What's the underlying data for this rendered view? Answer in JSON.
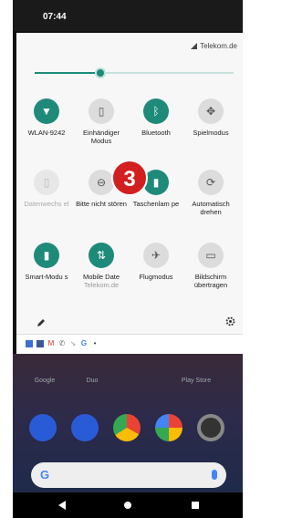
{
  "status_bar": {
    "time": "07:44"
  },
  "quick_settings": {
    "carrier": "Telekom.de",
    "brightness": 0.33,
    "tiles": [
      {
        "name": "wifi",
        "label": "WLAN-9242",
        "sub": "",
        "state": "on",
        "icon": "wifi-icon"
      },
      {
        "name": "adaptive-mode",
        "label": "Einhändiger Modus",
        "sub": "",
        "state": "off",
        "icon": "one-handed-icon"
      },
      {
        "name": "bluetooth",
        "label": "Bluetooth",
        "sub": "",
        "state": "on",
        "icon": "bluetooth-icon"
      },
      {
        "name": "game-mode",
        "label": "Spielmodus",
        "sub": "",
        "state": "off",
        "icon": "gamepad-icon"
      },
      {
        "name": "data-saver",
        "label": "Datenwechs el",
        "sub": "",
        "state": "dim",
        "icon": "data-switch-icon"
      },
      {
        "name": "do-not-disturb",
        "label": "Bitte nicht stören",
        "sub": "",
        "state": "off",
        "icon": "dnd-icon"
      },
      {
        "name": "flashlight",
        "label": "Taschenlam pe",
        "sub": "",
        "state": "on",
        "icon": "flashlight-icon"
      },
      {
        "name": "auto-rotate",
        "label": "Automatisch drehen",
        "sub": "",
        "state": "off",
        "icon": "rotate-icon"
      },
      {
        "name": "smart-mode",
        "label": "Smart-Modu s",
        "sub": "",
        "state": "on",
        "icon": "battery-icon"
      },
      {
        "name": "mobile-data",
        "label": "Mobile Date",
        "sub": "Telekom.de",
        "state": "on",
        "icon": "data-arrows-icon"
      },
      {
        "name": "airplane-mode",
        "label": "Flugmodus",
        "sub": "",
        "state": "off",
        "icon": "airplane-icon"
      },
      {
        "name": "screen-cast",
        "label": "Bildschirm übertragen",
        "sub": "",
        "state": "off",
        "icon": "cast-icon"
      }
    ],
    "overlay_badge": "3"
  },
  "home": {
    "apps": [
      "Google",
      "Duo",
      "",
      "Play Store"
    ],
    "search_logo": "G"
  },
  "colors": {
    "accent": "#1e8a7a",
    "badge": "#d21f1f"
  }
}
